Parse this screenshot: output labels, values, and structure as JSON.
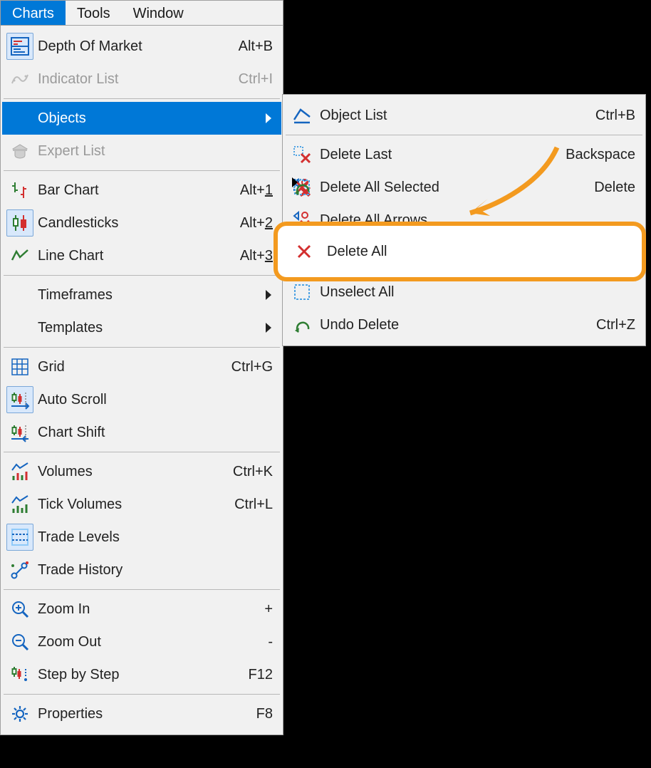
{
  "menubar": {
    "items": [
      {
        "label": "Charts",
        "active": true
      },
      {
        "label": "Tools",
        "active": false
      },
      {
        "label": "Window",
        "active": false
      }
    ]
  },
  "dropdown": {
    "items": [
      {
        "type": "item",
        "icon": "depth-of-market-icon",
        "label": "Depth Of Market",
        "shortcut": "Alt+B",
        "boxed": true
      },
      {
        "type": "item",
        "icon": "indicator-list-icon",
        "label": "Indicator List",
        "shortcut": "Ctrl+I",
        "disabled": true
      },
      {
        "type": "sep"
      },
      {
        "type": "item",
        "icon": "",
        "label": "Objects",
        "arrow": true,
        "highlight": true
      },
      {
        "type": "item",
        "icon": "expert-list-icon",
        "label": "Expert List",
        "disabled": true
      },
      {
        "type": "sep"
      },
      {
        "type": "item",
        "icon": "bar-chart-icon",
        "label": "Bar Chart",
        "shortcut": "Alt+",
        "shortcut_underline": "1"
      },
      {
        "type": "item",
        "icon": "candlesticks-icon",
        "label": "Candlesticks",
        "shortcut": "Alt+",
        "shortcut_underline": "2",
        "boxed": true
      },
      {
        "type": "item",
        "icon": "line-chart-icon",
        "label": "Line Chart",
        "shortcut": "Alt+",
        "shortcut_underline": "3"
      },
      {
        "type": "sep"
      },
      {
        "type": "item",
        "icon": "",
        "label": "Timeframes",
        "arrow": true
      },
      {
        "type": "item",
        "icon": "",
        "label": "Templates",
        "arrow": true
      },
      {
        "type": "sep"
      },
      {
        "type": "item",
        "icon": "grid-icon",
        "label": "Grid",
        "shortcut": "Ctrl+G"
      },
      {
        "type": "item",
        "icon": "auto-scroll-icon",
        "label": "Auto Scroll",
        "boxed": true
      },
      {
        "type": "item",
        "icon": "chart-shift-icon",
        "label": "Chart Shift"
      },
      {
        "type": "sep"
      },
      {
        "type": "item",
        "icon": "volumes-icon",
        "label": "Volumes",
        "shortcut": "Ctrl+K"
      },
      {
        "type": "item",
        "icon": "tick-volumes-icon",
        "label": "Tick Volumes",
        "shortcut": "Ctrl+L"
      },
      {
        "type": "item",
        "icon": "trade-levels-icon",
        "label": "Trade Levels",
        "boxed": true
      },
      {
        "type": "item",
        "icon": "trade-history-icon",
        "label": "Trade History"
      },
      {
        "type": "sep"
      },
      {
        "type": "item",
        "icon": "zoom-in-icon",
        "label": "Zoom In",
        "shortcut": "+"
      },
      {
        "type": "item",
        "icon": "zoom-out-icon",
        "label": "Zoom Out",
        "shortcut": "-"
      },
      {
        "type": "item",
        "icon": "step-by-step-icon",
        "label": "Step by Step",
        "shortcut": "F12"
      },
      {
        "type": "sep"
      },
      {
        "type": "item",
        "icon": "properties-icon",
        "label": "Properties",
        "shortcut": "F8"
      }
    ]
  },
  "submenu": {
    "items": [
      {
        "type": "item",
        "icon": "object-list-icon",
        "label": "Object List",
        "shortcut": "Ctrl+B"
      },
      {
        "type": "sep"
      },
      {
        "type": "item",
        "icon": "delete-last-icon",
        "label": "Delete Last",
        "shortcut": "Backspace"
      },
      {
        "type": "item",
        "icon": "delete-selected-icon",
        "label": "Delete All Selected",
        "shortcut": "Delete"
      },
      {
        "type": "item",
        "icon": "delete-arrows-icon",
        "label": "Delete All Arrows"
      },
      {
        "type": "item",
        "icon": "delete-all-icon",
        "label": "Delete All"
      },
      {
        "type": "sep"
      },
      {
        "type": "item",
        "icon": "unselect-all-icon",
        "label": "Unselect All"
      },
      {
        "type": "item",
        "icon": "undo-delete-icon",
        "label": "Undo Delete",
        "shortcut": "Ctrl+Z"
      }
    ]
  },
  "callout": {
    "icon": "delete-all-icon",
    "label": "Delete All"
  },
  "colors": {
    "accent": "#0078d7",
    "callout": "#f39a1f"
  }
}
